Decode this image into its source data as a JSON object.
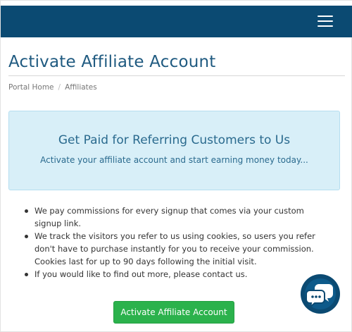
{
  "header": {
    "menu_icon": "hamburger-menu-icon",
    "background": "#0b4a72"
  },
  "page": {
    "title": "Activate Affiliate Account"
  },
  "breadcrumb": {
    "items": [
      "Portal Home",
      "Affiliates"
    ],
    "separator": "/"
  },
  "callout": {
    "title": "Get Paid for Referring Customers to Us",
    "subtitle": "Activate your affiliate account and start earning money today..."
  },
  "info_list": [
    "We pay commissions for every signup that comes via your custom signup link.",
    "We track the visitors you refer to us using cookies, so users you refer don't have to purchase instantly for you to receive your commission. Cookies last for up to 90 days following the initial visit.",
    "If you would like to find out more, please contact us."
  ],
  "actions": {
    "activate_label": "Activate Affiliate Account",
    "activate_color": "#2bb24c"
  },
  "chat_widget": {
    "icon": "chat-bubbles-icon"
  }
}
